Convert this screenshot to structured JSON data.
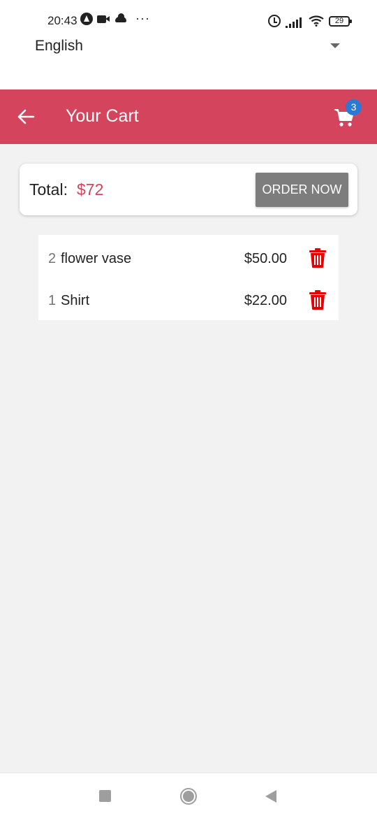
{
  "status_bar": {
    "time": "20:43",
    "dots": "···",
    "battery": "29"
  },
  "language_selector": {
    "selected": "English"
  },
  "app_bar": {
    "title": "Your Cart",
    "cart_count": "3",
    "color": "#d4455d"
  },
  "total_card": {
    "label": "Total:",
    "amount": "$72",
    "order_button": "ORDER NOW"
  },
  "cart_items": [
    {
      "qty": "2",
      "name": "flower vase",
      "price": "$50.00"
    },
    {
      "qty": "1",
      "name": "Shirt",
      "price": "$22.00"
    }
  ],
  "icons": {
    "back": "arrow-left-icon",
    "cart": "cart-icon",
    "delete": "trash-icon"
  },
  "colors": {
    "accent": "#d4455d",
    "badge": "#2979d6",
    "delete": "#e60000",
    "button": "#7d7d7d"
  }
}
